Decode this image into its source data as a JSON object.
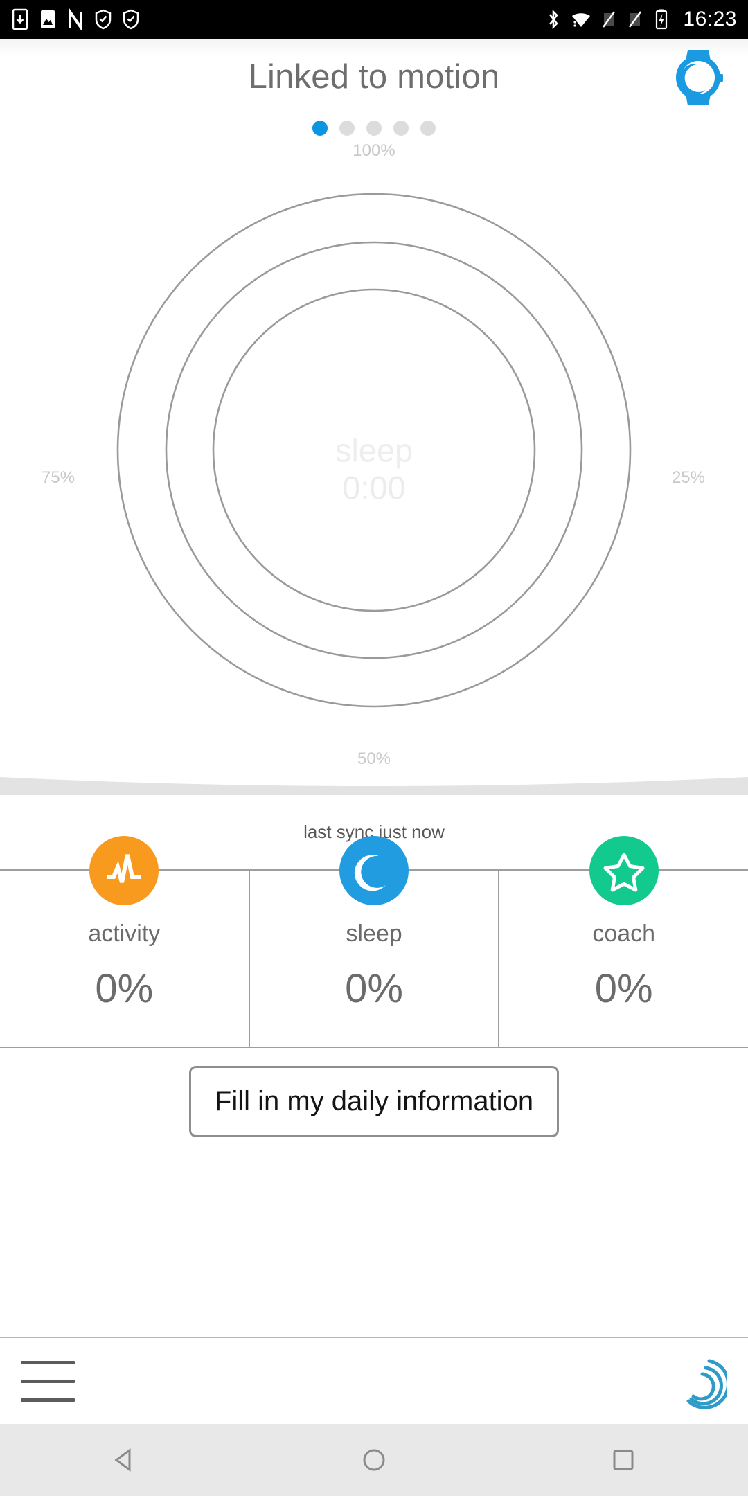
{
  "status_bar": {
    "time": "16:23",
    "left_icons": [
      "download-icon",
      "screenshot-icon",
      "nfc-icon",
      "shield-check-icon",
      "shield-check-icon"
    ],
    "right_icons": [
      "bluetooth-icon",
      "wifi-icon",
      "signal-off-icon",
      "signal-off-icon",
      "battery-charging-icon"
    ]
  },
  "header": {
    "title": "Linked to motion",
    "watch_icon": "watch-moon-icon"
  },
  "pager": {
    "count": 5,
    "active_index": 0,
    "active_color": "#0a96e0",
    "inactive_color": "#dcdcdc"
  },
  "gauge": {
    "center_label": "sleep",
    "center_value": "0:00",
    "tick_top": "100%",
    "tick_right": "25%",
    "tick_bottom": "50%",
    "tick_left": "75%",
    "ring_color": "#9a9a9a",
    "rings": 3
  },
  "sync": {
    "text": "last sync just now"
  },
  "stats": [
    {
      "icon": "activity-pulse-icon",
      "label": "activity",
      "value": "0%",
      "color": "#f79a1e"
    },
    {
      "icon": "moon-icon",
      "label": "sleep",
      "value": "0%",
      "color": "#219ce0"
    },
    {
      "icon": "star-icon",
      "label": "coach",
      "value": "0%",
      "color": "#12ca8e"
    }
  ],
  "cta": {
    "label": "Fill in my daily information"
  },
  "bottom_bar": {
    "menu_icon": "hamburger-menu-icon",
    "brand_icon": "withings-spiral-logo",
    "brand_color": "#2e9bc9"
  },
  "nav_bar": {
    "back": "back-triangle-icon",
    "home": "home-circle-icon",
    "recents": "recents-square-icon"
  }
}
